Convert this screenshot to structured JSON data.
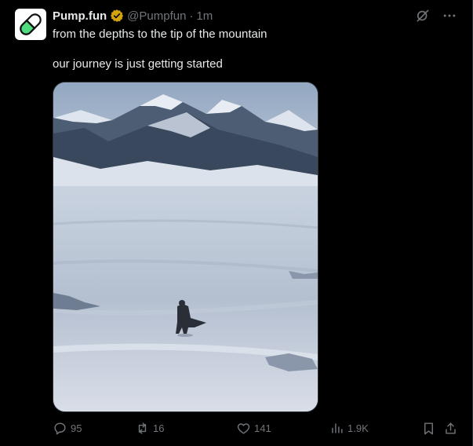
{
  "post": {
    "author_name": "Pump.fun",
    "handle": "@Pumpfun",
    "separator": "·",
    "time": "1m",
    "line1": "from the depths to the tip of the mountain",
    "line2": "our journey is just getting started"
  },
  "stats": {
    "replies": "95",
    "reposts": "16",
    "likes": "141",
    "views": "1.9K"
  },
  "colors": {
    "background": "#000000",
    "text": "#e7e9ea",
    "muted": "#71767b",
    "verified": "#d4a30c",
    "pill_green": "#4fdc7e"
  }
}
